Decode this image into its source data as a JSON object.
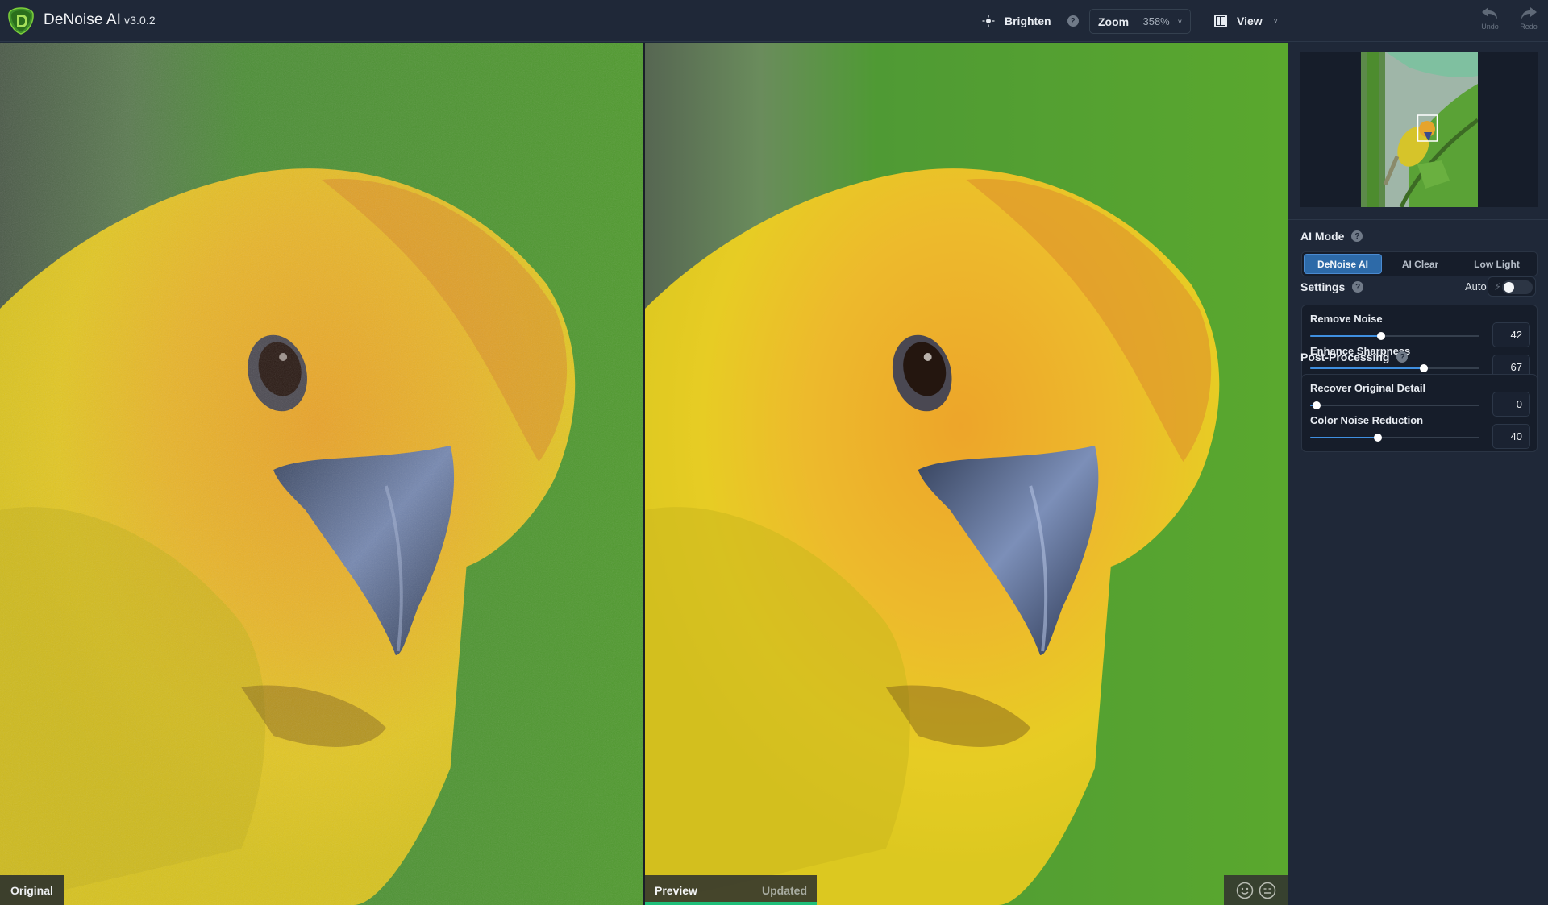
{
  "header": {
    "app_name": "DeNoise AI",
    "version": "v3.0.2",
    "brighten_label": "Brighten",
    "help_glyph": "?",
    "zoom_label": "Zoom",
    "zoom_value": "358%",
    "view_label": "View",
    "chevron_glyph": "˅",
    "undo_label": "Undo",
    "redo_label": "Redo",
    "icons": {
      "logo": "topaz-d-logo",
      "brighten": "sun-icon",
      "view": "split-view-icon",
      "undo": "undo-arrow-icon",
      "redo": "redo-arrow-icon"
    }
  },
  "views": {
    "original_label": "Original",
    "preview_label": "Preview",
    "preview_status": "Updated",
    "preview_progress": 1.0,
    "feedback_icons": [
      "smile-face-icon",
      "neutral-face-icon"
    ]
  },
  "sidebar": {
    "navigator": {
      "viewport_box": "highlight"
    },
    "ai_mode": {
      "title": "AI Mode",
      "options": [
        "DeNoise AI",
        "AI Clear",
        "Low Light"
      ],
      "selected": "DeNoise AI"
    },
    "settings": {
      "title": "Settings",
      "auto_label": "Auto",
      "auto_enabled": false,
      "bolt_glyph": "ϟ",
      "sliders": [
        {
          "label": "Remove Noise",
          "value": 42,
          "min": 0,
          "max": 100
        },
        {
          "label": "Enhance Sharpness",
          "value": 67,
          "min": 0,
          "max": 100
        }
      ]
    },
    "post_processing": {
      "title": "Post-Processing",
      "sliders": [
        {
          "label": "Recover Original Detail",
          "value": 0,
          "min": 0,
          "max": 100
        },
        {
          "label": "Color Noise Reduction",
          "value": 40,
          "min": 0,
          "max": 100
        }
      ]
    }
  },
  "colors": {
    "accent_blue": "#2d6aa8",
    "slider_fill": "#3f8fe0",
    "progress_green": "#1fbf7a",
    "bg_dark": "#1f2838"
  }
}
